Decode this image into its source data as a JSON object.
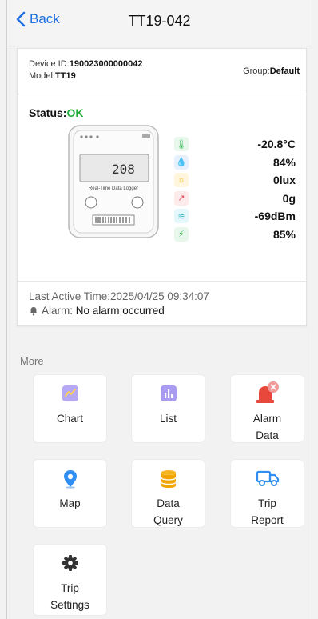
{
  "navbar": {
    "back_label": "Back",
    "title": "TT19-042"
  },
  "device": {
    "id_label": "Device ID:",
    "id_value": "190023000000042",
    "model_label": "Model:",
    "model_value": "TT19",
    "group_label": "Group:",
    "group_value": "Default",
    "status_label": "Status:",
    "status_value": "OK",
    "image_brand": "Real-Time Data Logger",
    "image_lcd": "208"
  },
  "metrics": [
    {
      "icon": "thermometer-icon",
      "value": "-20.8°C",
      "color": "#2fb24a"
    },
    {
      "icon": "humidity-icon",
      "value": "84%",
      "color": "#3a8ee6"
    },
    {
      "icon": "light-icon",
      "value": "0lux",
      "color": "#f2b51b"
    },
    {
      "icon": "shock-icon",
      "value": "0g",
      "color": "#e5535b"
    },
    {
      "icon": "signal-icon",
      "value": "-69dBm",
      "color": "#39b6c9"
    },
    {
      "icon": "battery-icon",
      "value": "85%",
      "color": "#2fb24a"
    }
  ],
  "last_active": "Last Active Time:2025/04/25 09:34:07",
  "alarm": {
    "label": "Alarm:",
    "value": "No alarm occurred"
  },
  "more_label": "More",
  "tiles": {
    "chart": "Chart",
    "list": "List",
    "alarm_data": [
      "Alarm",
      "Data"
    ],
    "map": "Map",
    "data_query": [
      "Data",
      "Query"
    ],
    "trip_report": [
      "Trip",
      "Report"
    ],
    "trip_settings": [
      "Trip",
      "Settings"
    ]
  },
  "colors": {
    "accent": "#1e6fe0",
    "ok": "#1fae3a",
    "alarm_red": "#e8473b"
  }
}
